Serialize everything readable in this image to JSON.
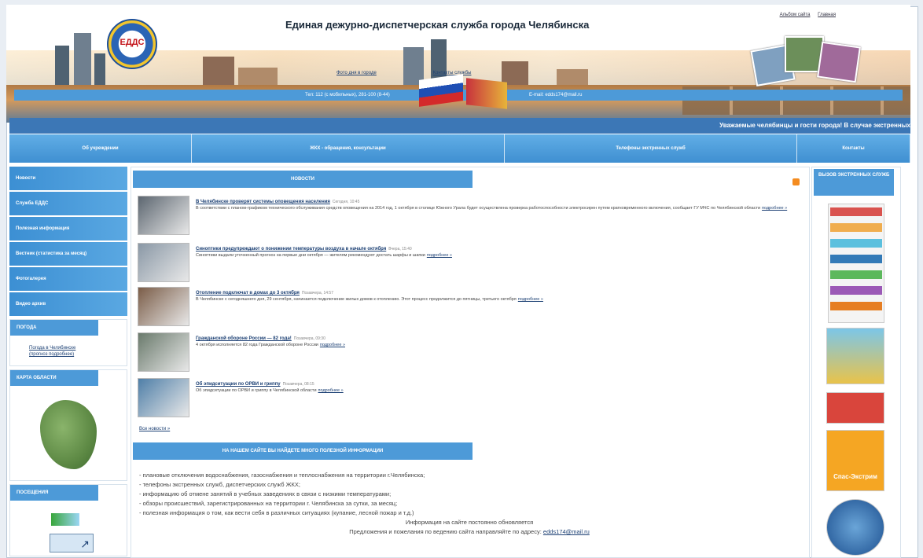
{
  "header": {
    "title": "Единая дежурно-диспетчерская служба города Челябинска",
    "logo_text": "ЕДДС",
    "top_links": [
      "Альбом сайта",
      "Главная"
    ],
    "mid_links": [
      "Фото дня в городе",
      "Контакты службы"
    ],
    "phone": "Тел: 112 (с мобильных), 281-100 (8-44)",
    "email": "E-mail: edds174@mail.ru"
  },
  "ticker": "Уважаемые челябинцы и гости города! В случае экстренных",
  "nav": [
    "Об учреждении",
    "ЖКХ - обращения, консультации",
    "Телефоны экстренных служб",
    "Контакты"
  ],
  "left_menu": [
    "Новости",
    "Служба ЕДДС",
    "Полезная информация",
    "Вестник (статистика за месяц)",
    "Фотогалерея",
    "Видео архив"
  ],
  "forecast": {
    "heading": "ПОГОДА",
    "links": [
      "Погода в Челябинске",
      "(прогноз подробнее)"
    ]
  },
  "map": {
    "heading": "КАРТА ОБЛАСТИ"
  },
  "visits": {
    "heading": "ПОСЕЩЕНИЯ",
    "counter_value": "↗"
  },
  "news": {
    "heading": "НОВОСТИ",
    "more_label": "подробнее »",
    "all_news": "Все новости »",
    "items": [
      {
        "title": "В Челябинске проверят системы оповещения населения",
        "date": "Сегодня, 10:45",
        "text": "В соответствии с планом-графиком технического обслуживания средств оповещения на 2014 год, 1 октября в столице Южного Урала будет осуществлена проверка работоспособности электросирен путем кратковременного включения, сообщает ГУ МЧС по Челябинской области",
        "thumb_color": "#5c6670"
      },
      {
        "title": "Синоптики предупреждают о понижении температуры воздуха в начале октября",
        "date": "Вчера, 15:40",
        "text": "Синоптики выдали уточненный прогноз на первые дни октября — жителям рекомендуют достать шарфы и шапки",
        "thumb_color": "#8a98a6"
      },
      {
        "title": "Отопление подключат в домах до 3 октября",
        "date": "Позавчера, 14:57",
        "text": "В Челябинске с сегодняшнего дня, 29 сентября, начинается подключение жилых домов к отоплению. Этот процесс продолжится до пятницы, третьего октября",
        "thumb_color": "#7b5d48"
      },
      {
        "title": "Гражданской обороне России — 82 года!",
        "date": "Позавчера, 09:30",
        "text": "4 октября исполняется 82 года Гражданской обороне России",
        "thumb_color": "#6a7a6c"
      },
      {
        "title": "Об эпидситуации по ОРВИ и гриппу",
        "date": "Позавчера, 08:15",
        "text": "Об эпидситуации по ОРВИ и гриппу в Челябинской области",
        "thumb_color": "#4f7fa8"
      }
    ]
  },
  "info": {
    "heading": "НА НАШЕМ САЙТЕ ВЫ НАЙДЕТЕ МНОГО ПОЛЕЗНОЙ ИНФОРМАЦИИ",
    "items": [
      "- плановые отключения водоснабжения, газоснабжения и теплоснабжения на территории г.Челябинска;",
      "- телефоны экстренных служб, диспетчерских служб ЖКХ;",
      "- информацию об отмене занятий в учебных заведениях в связи с низкими температурами;",
      "- обзоры происшествий, зарегистрированных на территории г. Челябинска за сутки, за месяц;",
      "- полезная информация о том, как вести себя в различных ситуациях (купание, лесной пожар и т.д.)"
    ],
    "note": "Информация на сайте постоянно обновляется",
    "proposal": "Предложения и пожелания по ведению сайта направляйте по адресу:",
    "email": "edds174@mail.ru"
  },
  "right": {
    "heading": "ВЫЗОВ ЭКСТРЕННЫХ СЛУЖБ",
    "banner_title": "Спас-Экстрим"
  },
  "colors": {
    "accent": "#4d9ad8",
    "nav": "#3f8fd1",
    "link": "#1b3f73"
  }
}
